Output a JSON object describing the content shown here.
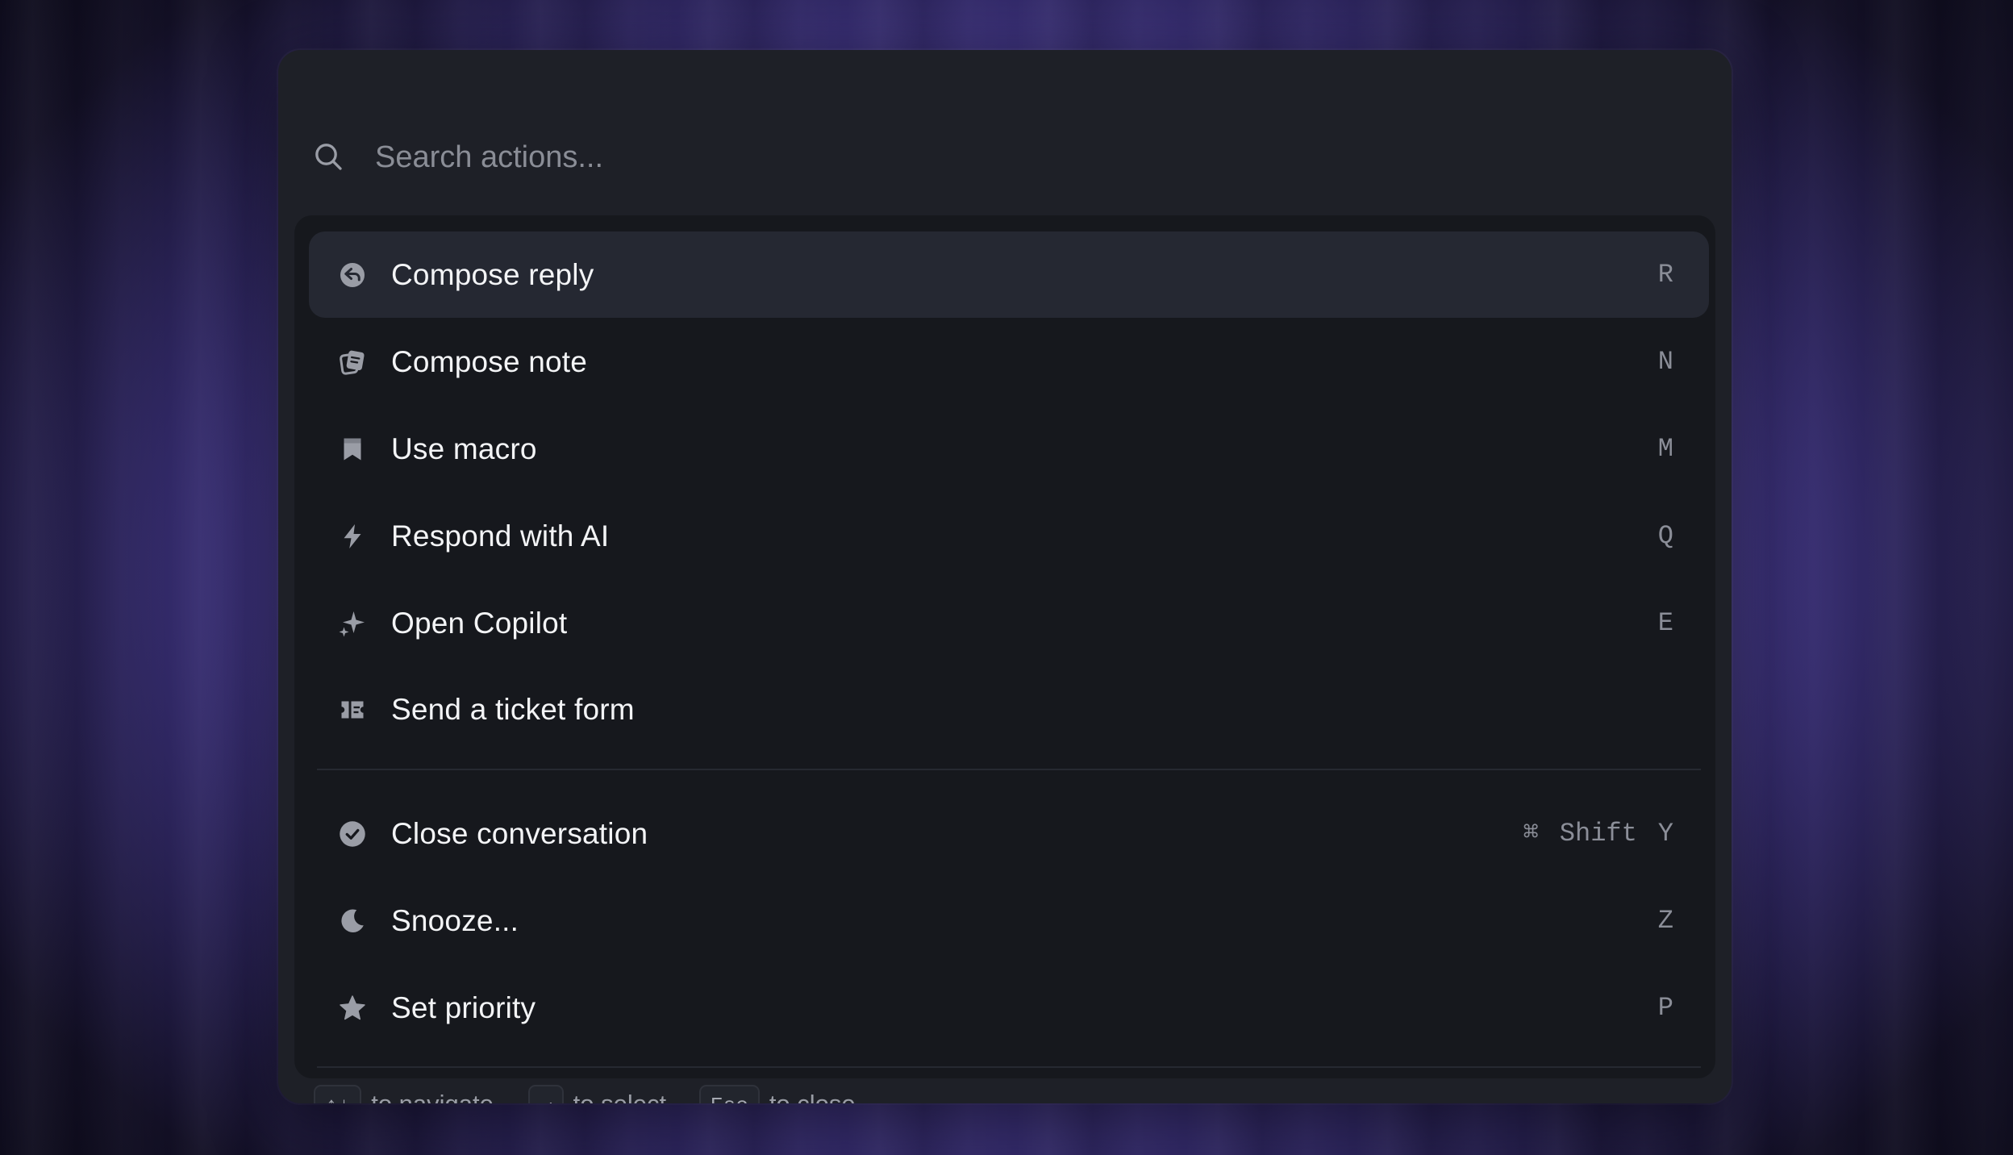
{
  "search": {
    "placeholder": "Search actions..."
  },
  "actions": [
    {
      "label": "Compose reply",
      "shortcut": [
        "R"
      ],
      "icon": "reply-icon",
      "active": true
    },
    {
      "label": "Compose note",
      "shortcut": [
        "N"
      ],
      "icon": "note-icon"
    },
    {
      "label": "Use macro",
      "shortcut": [
        "M"
      ],
      "icon": "bookmark-icon"
    },
    {
      "label": "Respond with AI",
      "shortcut": [
        "Q"
      ],
      "icon": "lightning-icon"
    },
    {
      "label": "Open Copilot",
      "shortcut": [
        "E"
      ],
      "icon": "sparkle-icon"
    },
    {
      "label": "Send a ticket form",
      "shortcut": [],
      "icon": "ticket-icon"
    },
    {
      "label": "Close conversation",
      "shortcut": [
        "⌘",
        "Shift",
        "Y"
      ],
      "icon": "check-circle-icon"
    },
    {
      "label": "Snooze...",
      "shortcut": [
        "Z"
      ],
      "icon": "moon-icon"
    },
    {
      "label": "Set priority",
      "shortcut": [
        "P"
      ],
      "icon": "star-icon"
    }
  ],
  "footer": {
    "navigate_key": "↑↓",
    "navigate_text": "to navigate",
    "select_key": "↵",
    "select_text": "to select",
    "close_key": "Esc",
    "close_text": "to close"
  },
  "colors": {
    "panel": "#1e2027",
    "list_bg": "#16181d",
    "active_row": "#252832",
    "text": "#f3f4f6",
    "muted": "#8b8e98",
    "backdrop_accent": "#7f6fe0"
  }
}
